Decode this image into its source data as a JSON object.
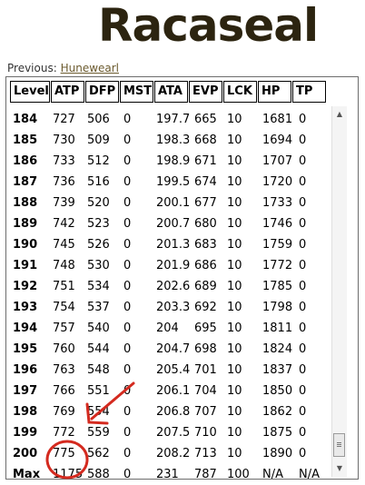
{
  "page": {
    "title": "Racaseal",
    "previous_label": "Previous: ",
    "previous_link": "Hunewearl"
  },
  "table": {
    "headers": [
      "Level",
      "ATP",
      "DFP",
      "MST",
      "ATA",
      "EVP",
      "LCK",
      "HP",
      "TP"
    ],
    "rows": [
      [
        "184",
        "727",
        "506",
        "0",
        "197.7",
        "665",
        "10",
        "1681",
        "0"
      ],
      [
        "185",
        "730",
        "509",
        "0",
        "198.3",
        "668",
        "10",
        "1694",
        "0"
      ],
      [
        "186",
        "733",
        "512",
        "0",
        "198.9",
        "671",
        "10",
        "1707",
        "0"
      ],
      [
        "187",
        "736",
        "516",
        "0",
        "199.5",
        "674",
        "10",
        "1720",
        "0"
      ],
      [
        "188",
        "739",
        "520",
        "0",
        "200.1",
        "677",
        "10",
        "1733",
        "0"
      ],
      [
        "189",
        "742",
        "523",
        "0",
        "200.7",
        "680",
        "10",
        "1746",
        "0"
      ],
      [
        "190",
        "745",
        "526",
        "0",
        "201.3",
        "683",
        "10",
        "1759",
        "0"
      ],
      [
        "191",
        "748",
        "530",
        "0",
        "201.9",
        "686",
        "10",
        "1772",
        "0"
      ],
      [
        "192",
        "751",
        "534",
        "0",
        "202.6",
        "689",
        "10",
        "1785",
        "0"
      ],
      [
        "193",
        "754",
        "537",
        "0",
        "203.3",
        "692",
        "10",
        "1798",
        "0"
      ],
      [
        "194",
        "757",
        "540",
        "0",
        "204",
        "695",
        "10",
        "1811",
        "0"
      ],
      [
        "195",
        "760",
        "544",
        "0",
        "204.7",
        "698",
        "10",
        "1824",
        "0"
      ],
      [
        "196",
        "763",
        "548",
        "0",
        "205.4",
        "701",
        "10",
        "1837",
        "0"
      ],
      [
        "197",
        "766",
        "551",
        "0",
        "206.1",
        "704",
        "10",
        "1850",
        "0"
      ],
      [
        "198",
        "769",
        "554",
        "0",
        "206.8",
        "707",
        "10",
        "1862",
        "0"
      ],
      [
        "199",
        "772",
        "559",
        "0",
        "207.5",
        "710",
        "10",
        "1875",
        "0"
      ],
      [
        "200",
        "775",
        "562",
        "0",
        "208.2",
        "713",
        "10",
        "1890",
        "0"
      ],
      [
        "Max",
        "1175",
        "588",
        "0",
        "231",
        "787",
        "100",
        "N/A",
        "N/A"
      ]
    ]
  },
  "annotation": {
    "color": "#d42a1f"
  },
  "icons": {
    "scroll_thumb": "scrollbar-grip-icon"
  }
}
